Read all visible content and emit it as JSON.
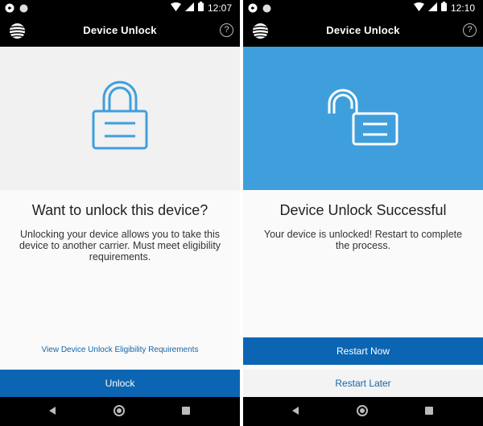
{
  "left": {
    "status_time": "12:07",
    "app_title": "Device Unlock",
    "help_glyph": "?",
    "headline": "Want to unlock this device?",
    "description": "Unlocking your device allows you to take this device to another carrier. Must meet eligibility requirements.",
    "eligibility_link": "View Device Unlock Eligibility Requirements",
    "unlock_button": "Unlock"
  },
  "right": {
    "status_time": "12:10",
    "app_title": "Device Unlock",
    "help_glyph": "?",
    "headline": "Device Unlock Successful",
    "description": "Your device is unlocked! Restart to complete the process.",
    "restart_now_button": "Restart Now",
    "restart_later_button": "Restart Later"
  },
  "icons": {
    "brand_logo": "globe-logo-icon",
    "help": "help-circle-icon",
    "lock_closed": "padlock-closed-icon",
    "lock_open": "padlock-open-icon",
    "nav_back": "back-triangle-icon",
    "nav_home": "home-circle-icon",
    "nav_recent": "recents-square-icon"
  },
  "colors": {
    "appbar": "#000000",
    "primary_button": "#0b65b3",
    "success_hero": "#3f9fdc",
    "link": "#1565a8",
    "lock_stroke": "#3f9fdc"
  }
}
